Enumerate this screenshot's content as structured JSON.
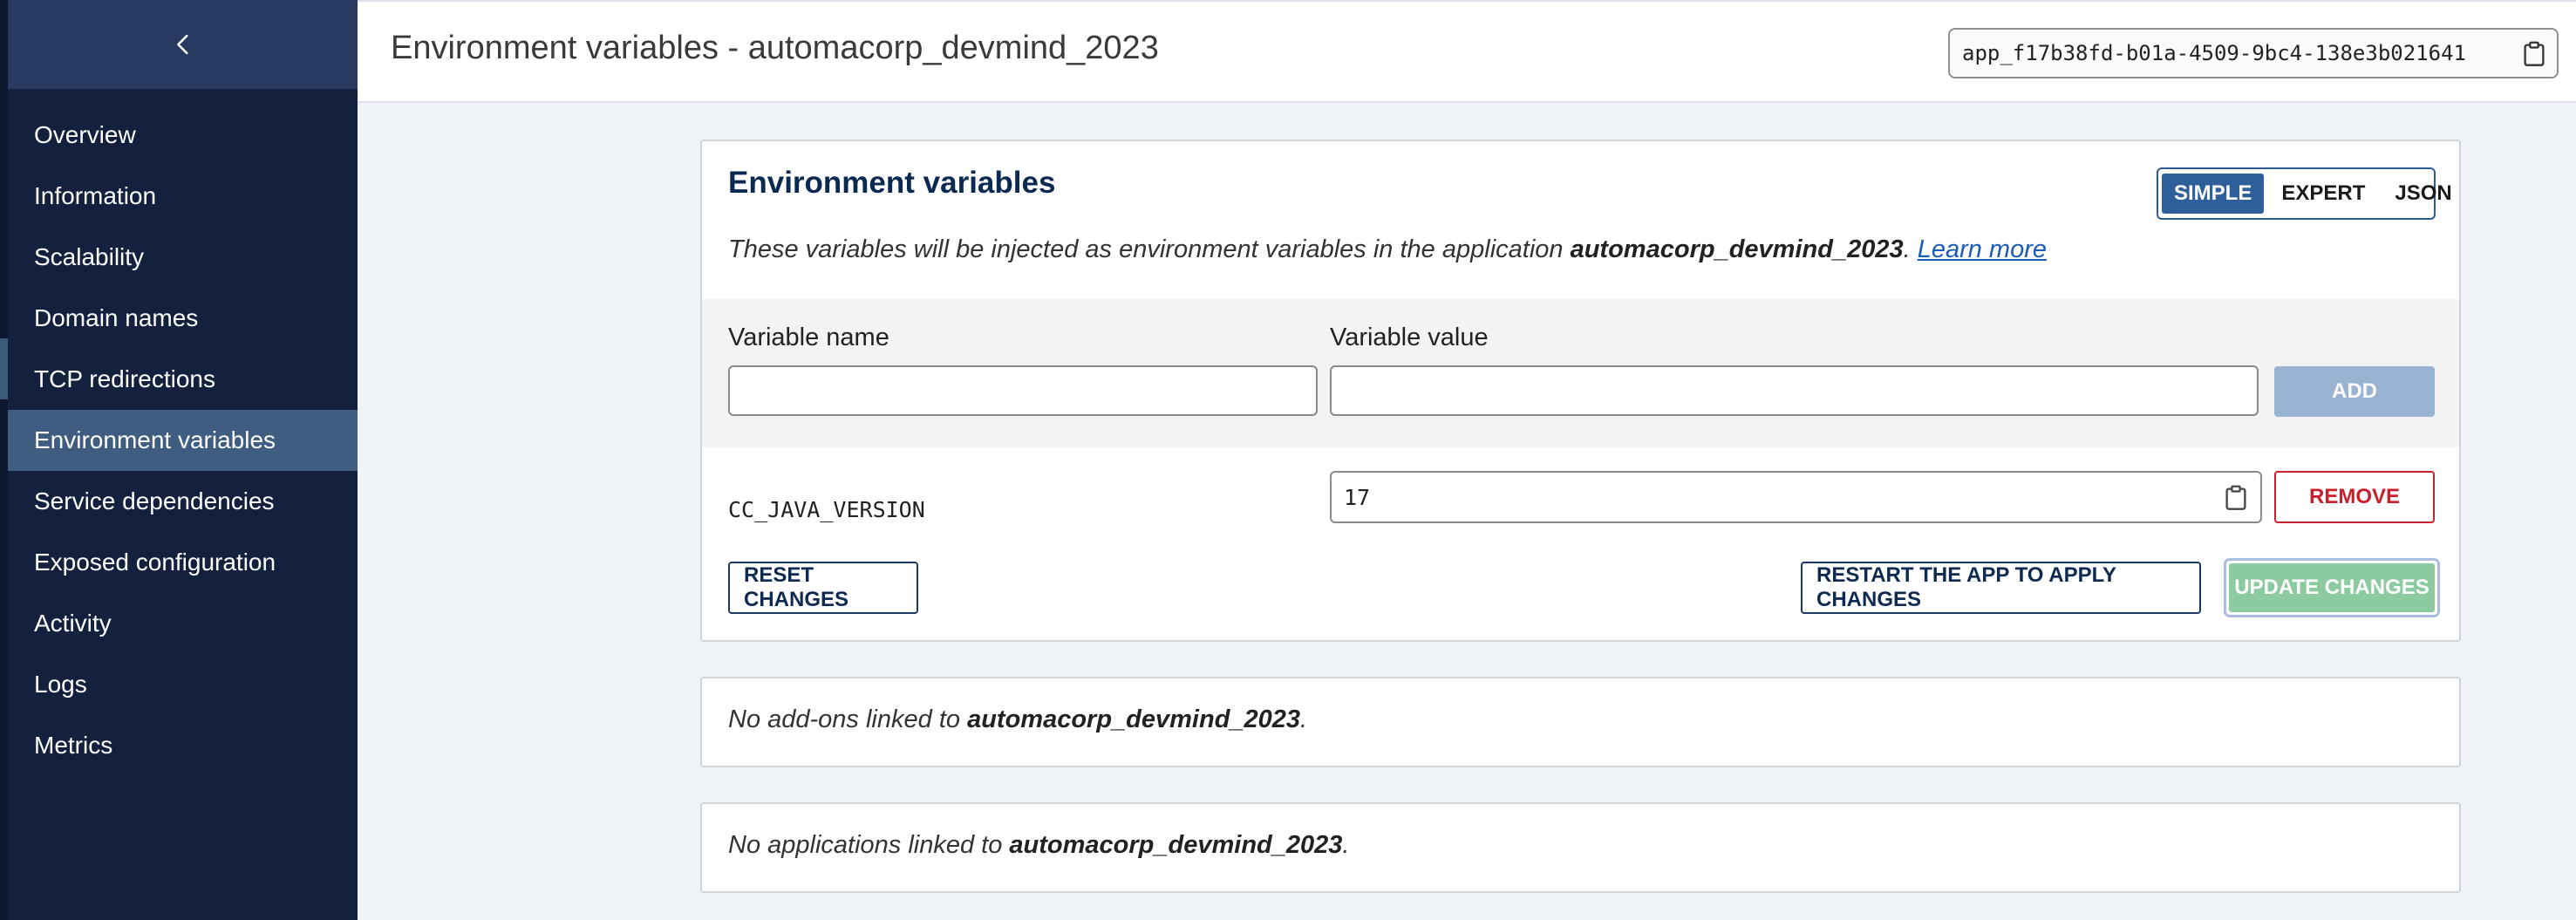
{
  "sidebar": {
    "collapse_icon": "chevron-left-icon",
    "items": [
      {
        "label": "Overview"
      },
      {
        "label": "Information"
      },
      {
        "label": "Scalability"
      },
      {
        "label": "Domain names"
      },
      {
        "label": "TCP redirections"
      },
      {
        "label": "Environment variables",
        "active": true
      },
      {
        "label": "Service dependencies"
      },
      {
        "label": "Exposed configuration"
      },
      {
        "label": "Activity"
      },
      {
        "label": "Logs"
      },
      {
        "label": "Metrics"
      }
    ]
  },
  "header": {
    "title": "Environment variables - automacorp_devmind_2023",
    "app_id": "app_f17b38fd-b01a-4509-9bc4-138e3b021641",
    "copy_icon": "clipboard-icon"
  },
  "env_card": {
    "title": "Environment variables",
    "modes": {
      "simple": "SIMPLE",
      "expert": "EXPERT",
      "json": "JSON",
      "selected": "SIMPLE"
    },
    "description_prefix": "These variables will be injected as environment variables in the application ",
    "app_name": "automacorp_devmind_2023",
    "description_suffix": ".",
    "learn_more": "Learn more",
    "new_variable": {
      "name_label": "Variable name",
      "value_label": "Variable value",
      "name_value": "",
      "value_value": "",
      "add_label": "ADD"
    },
    "variables": [
      {
        "name": "CC_JAVA_VERSION",
        "value": "17",
        "remove_label": "REMOVE"
      }
    ],
    "reset_label": "RESET CHANGES",
    "restart_label": "RESTART THE APP TO APPLY CHANGES",
    "update_label": "UPDATE CHANGES"
  },
  "addons_card": {
    "prefix": "No add-ons linked to ",
    "app_name": "automacorp_devmind_2023",
    "suffix": "."
  },
  "apps_card": {
    "prefix": "No applications linked to ",
    "app_name": "automacorp_devmind_2023",
    "suffix": "."
  },
  "colors": {
    "sidebar_bg": "#13213e",
    "sidebar_active": "#3e5d80",
    "accent": "#2f5f9a",
    "danger": "#c8202c",
    "success_disabled": "#8ccaa0"
  }
}
